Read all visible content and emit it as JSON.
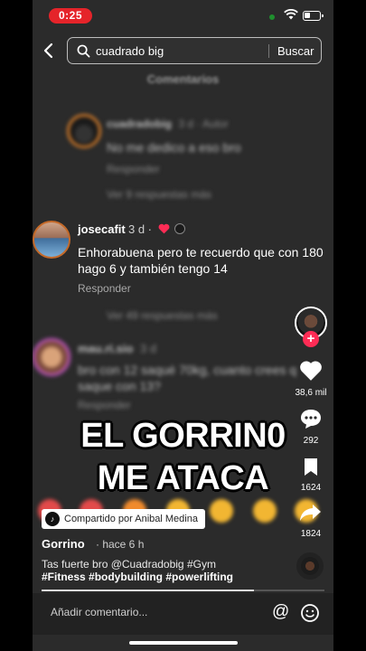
{
  "status_bar": {
    "recording_time": "0:25"
  },
  "search": {
    "query": "cuadrado big",
    "submit_label": "Buscar"
  },
  "comments_panel": {
    "title": "Comentarios",
    "comments": [
      {
        "author": "cuadradobig",
        "meta": "3 d · Autor",
        "text": "No me dedico a eso bro",
        "reply_label": "Responder",
        "more_replies": "Ver 9 respuestas más"
      },
      {
        "author": "josecafit",
        "meta": "3 d ·",
        "text": "Enhorabuena pero te recuerdo que con 180 hago 6 y también tengo 14",
        "reply_label": "Responder",
        "more_replies": "Ver 49 respuestas más"
      },
      {
        "author": "mau.ri.sio",
        "meta": "3 d",
        "text": "bro con 12 saqué 70kg, cuanto crees q saque con 13?",
        "reply_label": "Responder"
      }
    ]
  },
  "caption": {
    "line1": "EL GORRIN0",
    "line2": "ME ATACA"
  },
  "rail": {
    "likes": "38,6 mil",
    "comments": "292",
    "saves": "1624",
    "shares": "1824"
  },
  "shared_pill": {
    "label": "Compartido por Anibal Medina"
  },
  "post": {
    "author": "Gorrino",
    "time": "· hace 6 h",
    "description": "Tas fuerte bro @Cuadradobig #Gym",
    "hashtags": "#Fitness #bodybuilding #powerlifting",
    "progress": 0.75
  },
  "comment_input": {
    "placeholder": "Añadir comentario..."
  },
  "icons": [
    "back-arrow-icon",
    "search-icon",
    "wifi-icon",
    "battery-icon",
    "heart-icon",
    "comment-bubble-icon",
    "bookmark-icon",
    "share-arrow-icon",
    "at-icon",
    "emoji-icon",
    "plus-icon",
    "music-disc-icon"
  ],
  "colors": {
    "accent": "#fe2c55",
    "record": "#e5242a",
    "background": "#2b2b2b"
  }
}
